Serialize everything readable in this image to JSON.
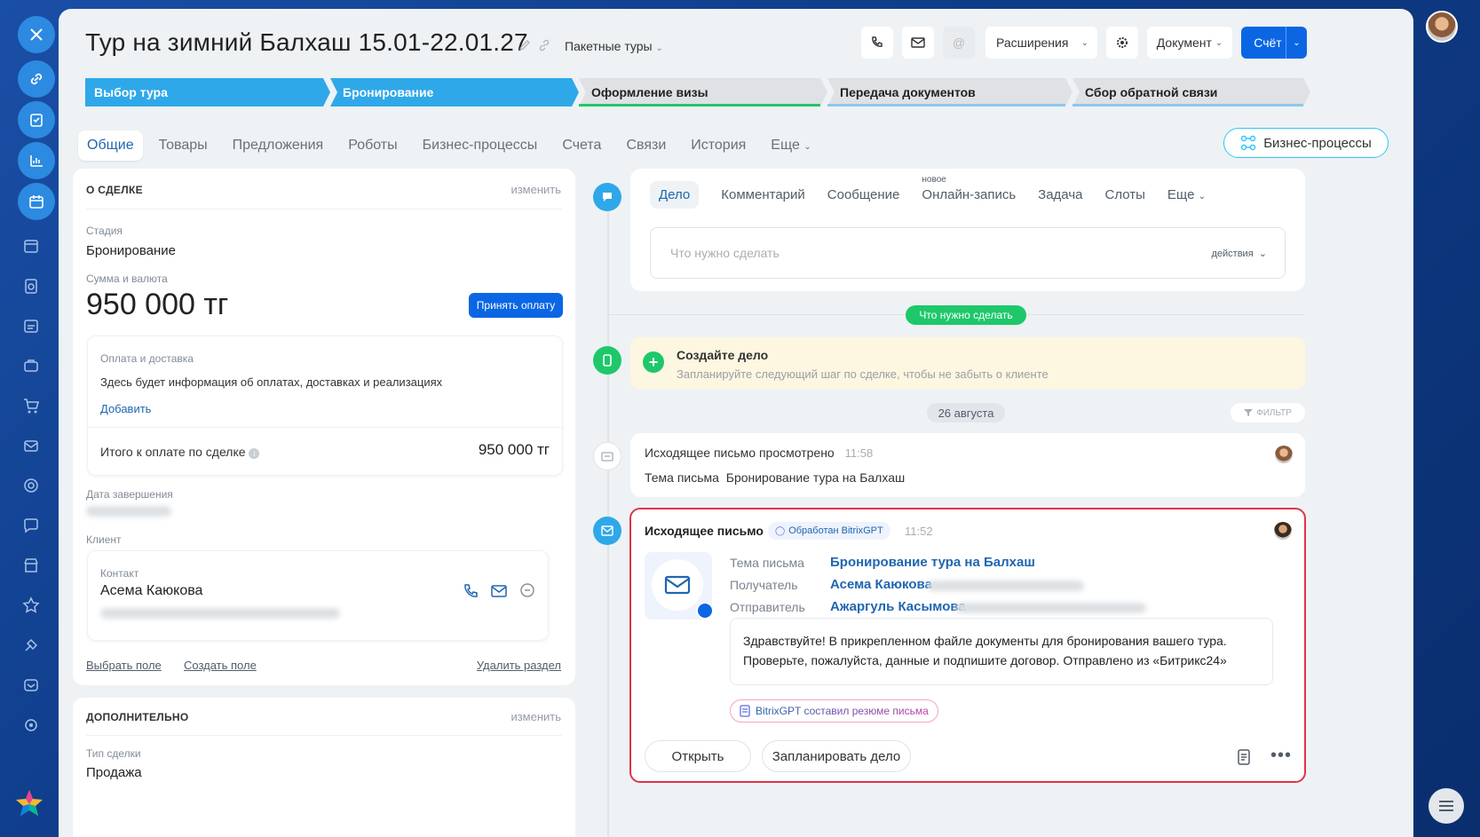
{
  "window": {
    "title": "Тур на зимний Балхаш 15.01-22.01.27",
    "category": "Пакетные туры"
  },
  "toolbar": {
    "extensions": "Расширения",
    "document": "Документ",
    "invoice": "Счёт"
  },
  "stages": [
    "Выбор тура",
    "Бронирование",
    "Оформление визы",
    "Передача документов",
    "Сбор обратной связи"
  ],
  "tabs": [
    "Общие",
    "Товары",
    "Предложения",
    "Роботы",
    "Бизнес-процессы",
    "Счета",
    "Связи",
    "История",
    "Еще"
  ],
  "bp_button": "Бизнес-процессы",
  "deal": {
    "header": "О СДЕЛКЕ",
    "edit": "изменить",
    "stage_label": "Стадия",
    "stage_value": "Бронирование",
    "amount_label": "Сумма и валюта",
    "amount_value": "950 000 тг",
    "pay_button": "Принять оплату",
    "payment_label": "Оплата и доставка",
    "payment_info": "Здесь будет информация об оплатах, доставках и реализациях",
    "add_link": "Добавить",
    "total_label": "Итого к оплате по сделке",
    "total_value": "950 000 тг",
    "end_date_label": "Дата завершения",
    "client_label": "Клиент",
    "contact_label": "Контакт",
    "contact_name": "Асема Каюкова",
    "choose_field": "Выбрать поле",
    "create_field": "Создать поле",
    "delete_section": "Удалить раздел"
  },
  "extra": {
    "header": "ДОПОЛНИТЕЛЬНО",
    "edit": "изменить",
    "type_label": "Тип сделки",
    "type_value": "Продажа"
  },
  "activity": {
    "tabs": [
      "Дело",
      "Комментарий",
      "Сообщение",
      "Онлайн-запись",
      "Задача",
      "Слоты",
      "Еще"
    ],
    "new_badge": "новое",
    "placeholder": "Что нужно сделать",
    "actions": "действия"
  },
  "timeline": {
    "todo_pill": "Что нужно сделать",
    "create_title": "Создайте дело",
    "create_desc": "Запланируйте следующий шаг по сделке, чтобы не забыть о клиенте",
    "date_pill": "26 августа",
    "filter": "ФИЛЬТР",
    "viewed": {
      "title": "Исходящее письмо просмотрено",
      "time": "11:58",
      "subject_label": "Тема письма",
      "subject": "Бронирование тура на Балхаш"
    },
    "email": {
      "title": "Исходящее письмо",
      "badge": "Обработан BitrixGPT",
      "time": "11:52",
      "subject_label": "Тема письма",
      "subject": "Бронирование тура на Балхаш",
      "recipient_label": "Получатель",
      "recipient": "Асема Каюкова",
      "sender_label": "Отправитель",
      "sender": "Ажаргуль Касымова",
      "body": "Здравствуйте! В прикрепленном файле документы для бронирования вашего тура. Проверьте, пожалуйста, данные и подпишите договор. Отправлено из «Битрикс24»",
      "gpt_summary": "BitrixGPT составил резюме письма",
      "open": "Открыть",
      "plan": "Запланировать дело"
    }
  },
  "colors": {
    "accent": "#2fc6f6",
    "stage_active": "#2fa8e9",
    "green": "#1ec86a",
    "red_border": "#e0334a",
    "primary": "#0b66e4"
  }
}
